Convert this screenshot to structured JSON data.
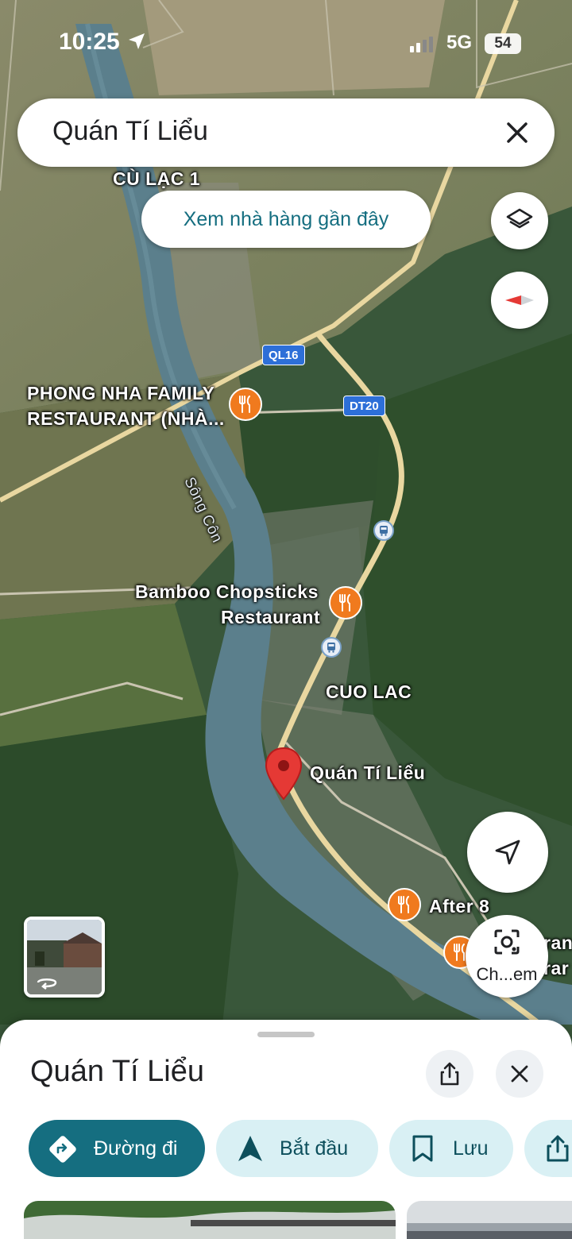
{
  "status_bar": {
    "time": "10:25",
    "network": "5G",
    "battery": "54"
  },
  "search": {
    "query": "Quán Tí Liểu"
  },
  "nearby_button": {
    "label": "Xem nhà hàng gần đây"
  },
  "map_labels": {
    "village_1": "CÙ LẠC 1",
    "village_2": "CUO LAC",
    "river": "Sông Côn",
    "route_ql16": "QL16",
    "route_dt20": "DT20",
    "poi_1_line1": "PHONG NHA FAMILY",
    "poi_1_line2": "RESTAURANT (NHÀ...",
    "poi_2_line1": "Bamboo Chopsticks",
    "poi_2_line2": "Restaurant",
    "poi_3": "After 8",
    "poi_4_partial_1": "ran",
    "poi_4_partial_2": "rar",
    "selected_place": "Quán Tí Liểu"
  },
  "lens_button": {
    "label": "Ch...em"
  },
  "sheet": {
    "title": "Quán Tí Liểu",
    "actions": [
      {
        "label": "Đường đi",
        "icon": "directions-icon"
      },
      {
        "label": "Bắt đầu",
        "icon": "navigation-arrow-icon"
      },
      {
        "label": "Lưu",
        "icon": "bookmark-icon"
      },
      {
        "label": "",
        "icon": "share-icon"
      }
    ]
  },
  "colors": {
    "accent": "#156e80",
    "chip_bg": "#d9f0f4",
    "poi": "#f07a1e",
    "pin": "#e53935",
    "road": "#e9d7a0"
  }
}
